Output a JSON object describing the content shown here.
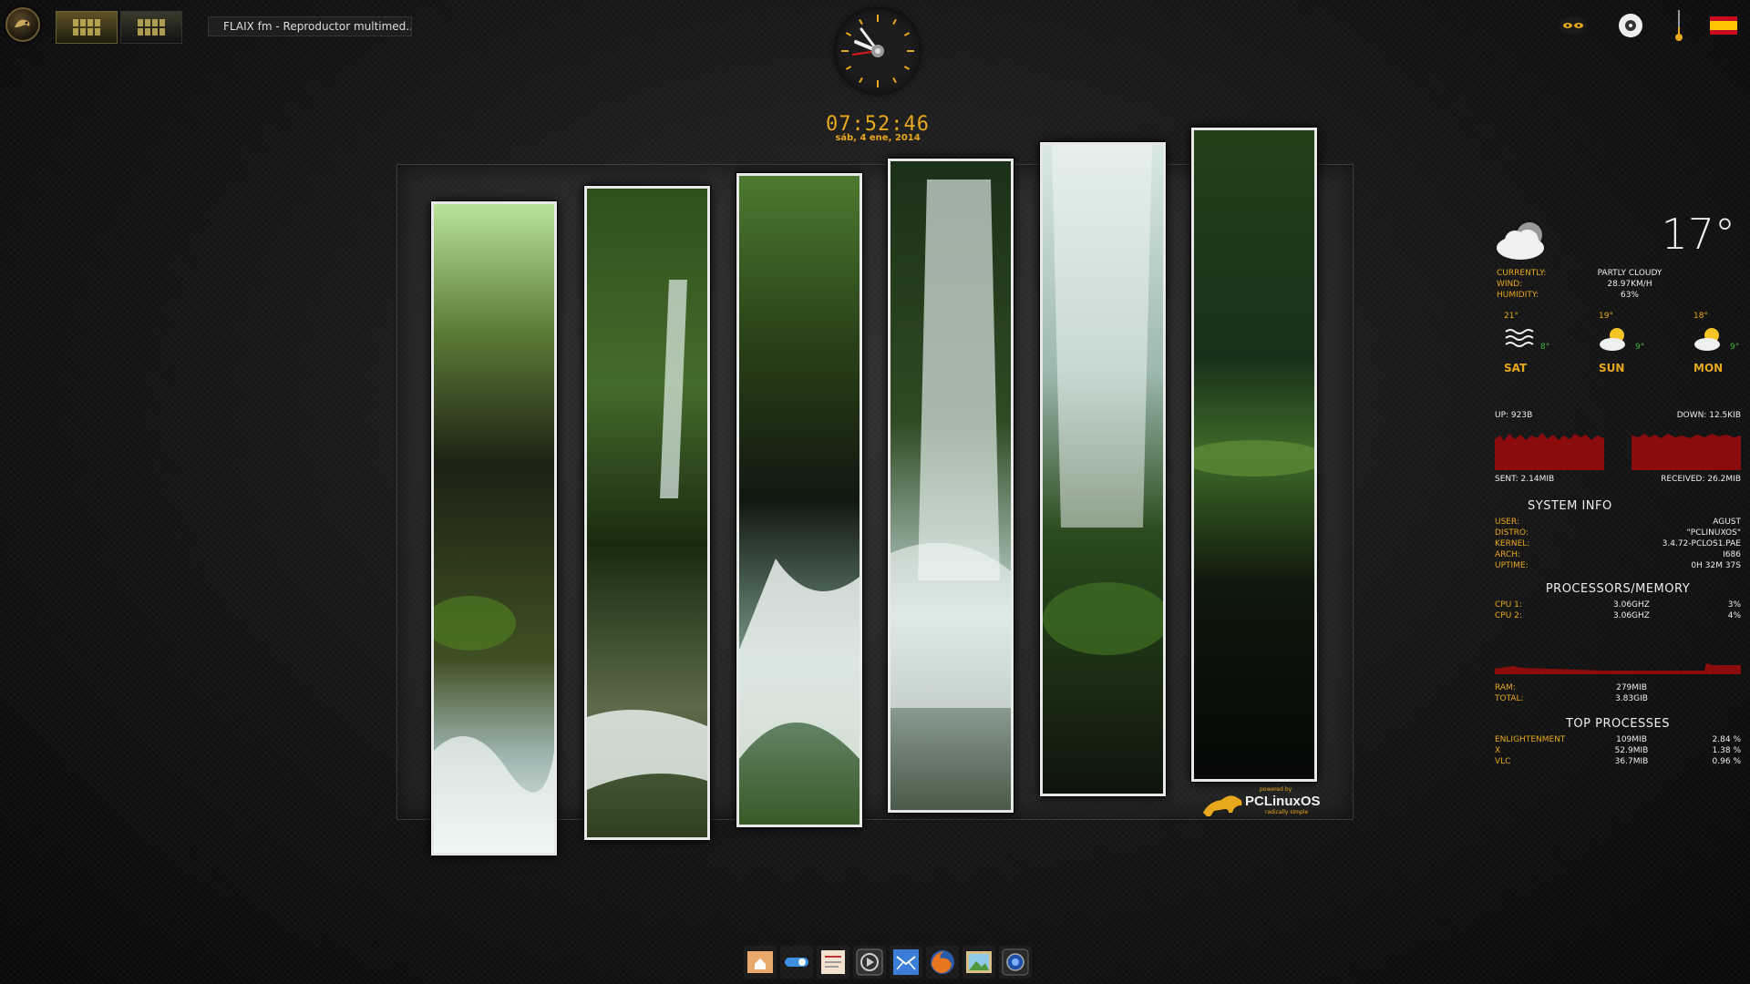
{
  "shelf": {
    "start_icon": "enlightenment-menu-icon",
    "pagers": [
      "desktop-1",
      "desktop-2"
    ],
    "task_title": "FLAIX fm - Reproductor multimed..."
  },
  "clock": {
    "time": "07:52:46",
    "date": "sáb, 4 ene, 2014"
  },
  "tray": {
    "icons": [
      "eyes-icon",
      "disc-icon",
      "thermometer-icon",
      "spain-flag-icon"
    ]
  },
  "weather": {
    "temperature": "17°",
    "currently_label": "CURRENTLY:",
    "currently_value": "PARTLY CLOUDY",
    "wind_label": "WIND:",
    "wind_value": "28.97KM/H",
    "humidity_label": "HUMIDITY:",
    "humidity_value": "63%",
    "forecast": [
      {
        "day": "SAT",
        "high": "21°",
        "low": "8°",
        "icon": "fog-icon"
      },
      {
        "day": "SUN",
        "high": "19°",
        "low": "9°",
        "icon": "partly-sunny-icon"
      },
      {
        "day": "MON",
        "high": "18°",
        "low": "9°",
        "icon": "partly-sunny-icon"
      }
    ]
  },
  "network": {
    "up": "UP: 923B",
    "down": "DOWN: 12.5KIB",
    "sent": "SENT: 2.14MIB",
    "received": "RECEIVED: 26.2MIB"
  },
  "system_info": {
    "title": "SYSTEM INFO",
    "rows": [
      {
        "label": "USER:",
        "value": "AGUST"
      },
      {
        "label": "DISTRO:",
        "value": "\"PCLINUXOS\""
      },
      {
        "label": "KERNEL:",
        "value": "3.4.72-PCLOS1.PAE"
      },
      {
        "label": "ARCH:",
        "value": "I686"
      },
      {
        "label": "UPTIME:",
        "value": "0H 32M 37S"
      }
    ]
  },
  "processors": {
    "title": "PROCESSORS/MEMORY",
    "rows": [
      {
        "label": "CPU 1:",
        "freq": "3.06GHZ",
        "usage": "3%"
      },
      {
        "label": "CPU 2:",
        "freq": "3.06GHZ",
        "usage": "4%"
      }
    ],
    "ram_label": "RAM:",
    "ram_value": "279MIB",
    "total_label": "TOTAL:",
    "total_value": "3.83GIB"
  },
  "top_processes": {
    "title": "TOP PROCESSES",
    "rows": [
      {
        "name": "ENLIGHTENMENT",
        "mem": "109MIB",
        "cpu": "2.84 %"
      },
      {
        "name": "X",
        "mem": "52.9MIB",
        "cpu": "1.38 %"
      },
      {
        "name": "VLC",
        "mem": "36.7MIB",
        "cpu": "0.96 %"
      }
    ]
  },
  "logo": {
    "powered": "powered by",
    "name": "PCLinuxOS",
    "tagline": "radically simple"
  },
  "dock": {
    "items": [
      "home-folder-icon",
      "settings-toggle-icon",
      "text-editor-icon",
      "media-player-icon",
      "mail-icon",
      "firefox-icon",
      "image-viewer-icon",
      "screenshot-icon"
    ]
  },
  "colors": {
    "accent": "#e8a81e",
    "graph": "#8b0c0c",
    "green": "#3dba3d"
  }
}
